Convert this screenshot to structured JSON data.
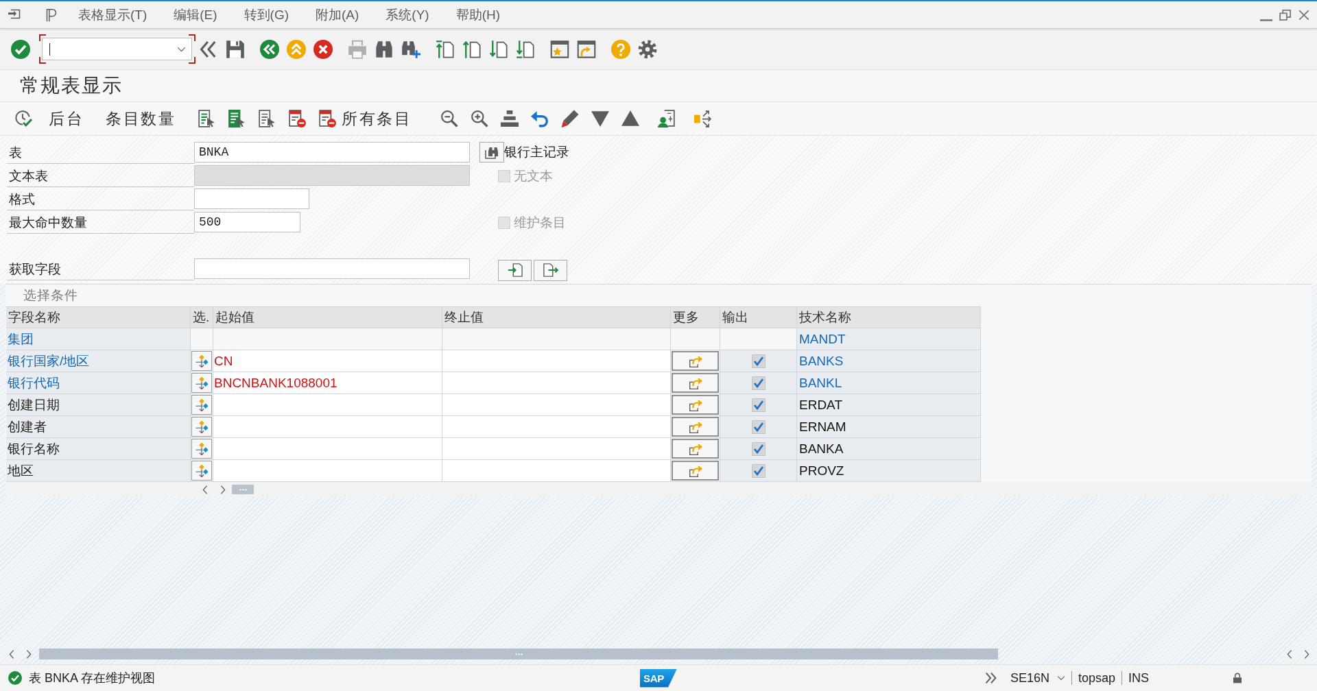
{
  "window": {
    "title": "常规表显示"
  },
  "menu_bar": {
    "items": [
      {
        "label": "表格显示(T)"
      },
      {
        "label": "编辑(E)"
      },
      {
        "label": "转到(G)"
      },
      {
        "label": "附加(A)"
      },
      {
        "label": "系统(Y)"
      },
      {
        "label": "帮助(H)"
      }
    ]
  },
  "toolbar": {
    "buttons": [
      {
        "kind": "enter",
        "disabled": false
      },
      {
        "kind": "back-double",
        "disabled": false
      },
      {
        "kind": "save",
        "disabled": false
      },
      {
        "kind": "back",
        "disabled": false
      },
      {
        "kind": "exit",
        "disabled": false
      },
      {
        "kind": "cancel",
        "disabled": false
      },
      {
        "kind": "print",
        "disabled": true
      },
      {
        "kind": "find",
        "disabled": false
      },
      {
        "kind": "find-next",
        "disabled": false
      },
      {
        "kind": "first-page",
        "disabled": false
      },
      {
        "kind": "previous-page",
        "disabled": false
      },
      {
        "kind": "next-page",
        "disabled": false
      },
      {
        "kind": "last-page",
        "disabled": false
      },
      {
        "kind": "new-session",
        "disabled": false
      },
      {
        "kind": "shortcut",
        "disabled": false
      },
      {
        "kind": "help",
        "disabled": false
      },
      {
        "kind": "settings",
        "disabled": false
      }
    ]
  },
  "app_toolbar": {
    "items": [
      {
        "kind": "execute"
      },
      {
        "kind": "text",
        "label": "后台"
      },
      {
        "kind": "text",
        "label": "条目数量"
      },
      {
        "kind": "doc-lines"
      },
      {
        "kind": "doc-filled"
      },
      {
        "kind": "doc-plain"
      },
      {
        "kind": "doc-minus"
      },
      {
        "kind": "doc-minus",
        "label": "所有条目"
      },
      {
        "kind": "zoom-out"
      },
      {
        "kind": "zoom-in"
      },
      {
        "kind": "stack"
      },
      {
        "kind": "undo"
      },
      {
        "kind": "pencil"
      },
      {
        "kind": "triangle-down"
      },
      {
        "kind": "triangle-up"
      },
      {
        "kind": "user-doc"
      },
      {
        "kind": "split"
      }
    ]
  },
  "form": {
    "fields": [
      {
        "label": "表",
        "value": "BNKA",
        "disabled": false
      },
      {
        "label": "文本表",
        "disabled": true
      },
      {
        "label": "格式",
        "disabled": false
      },
      {
        "label": "最大命中数量",
        "value": "500",
        "disabled": false
      },
      {
        "label": "获取字段",
        "disabled": false
      }
    ],
    "table_button": {
      "label": "银行主记录"
    },
    "options": [
      {
        "label": "无文本",
        "checked": false,
        "disabled": true
      },
      {
        "label": "维护条目",
        "checked": false,
        "disabled": true
      }
    ]
  },
  "selection": {
    "title": "选择条件",
    "columns": [
      "字段名称",
      "选.",
      "起始值",
      "终止值",
      "更多",
      "输出",
      "技术名称"
    ],
    "rows": [
      {
        "kind": "client",
        "field": "集团",
        "key": true,
        "tech_name": "MANDT"
      },
      {
        "kind": "field",
        "field": "银行国家/地区",
        "key": true,
        "from": "CN",
        "output": true,
        "tech_name": "BANKS"
      },
      {
        "kind": "field",
        "field": "银行代码",
        "key": true,
        "from": "BNCNBANK1088001",
        "output": true,
        "tech_name": "BANKL"
      },
      {
        "kind": "field",
        "field": "创建日期",
        "key": false,
        "output": true,
        "tech_name": "ERDAT"
      },
      {
        "kind": "field",
        "field": "创建者",
        "key": false,
        "output": true,
        "tech_name": "ERNAM"
      },
      {
        "kind": "field",
        "field": "银行名称",
        "key": false,
        "output": true,
        "tech_name": "BANKA"
      },
      {
        "kind": "field",
        "field": "地区",
        "key": false,
        "output": true,
        "tech_name": "PROVZ"
      }
    ]
  },
  "status": {
    "message": "表 BNKA 存在维护视图",
    "logo": "SAP",
    "transaction": "SE16N",
    "system": "topsap",
    "mode": "INS"
  }
}
